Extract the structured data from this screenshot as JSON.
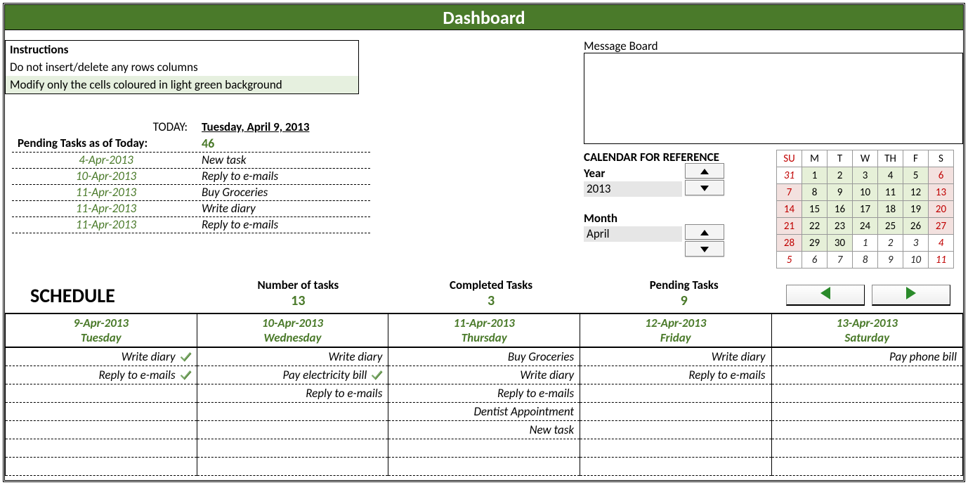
{
  "title": "Dashboard",
  "instructions": {
    "header": "Instructions",
    "line1": "Do not insert/delete any rows columns",
    "line2": "Modify only the cells coloured in light green background"
  },
  "message_board": {
    "label": "Message Board"
  },
  "today": {
    "label": "TODAY:",
    "value": "Tuesday, April 9, 2013"
  },
  "pending_summary": {
    "label": "Pending Tasks as of Today:",
    "count": "46"
  },
  "pending_list": [
    {
      "date": "4-Apr-2013",
      "task": "New task"
    },
    {
      "date": "10-Apr-2013",
      "task": "Reply to e-mails"
    },
    {
      "date": "11-Apr-2013",
      "task": "Buy Groceries"
    },
    {
      "date": "11-Apr-2013",
      "task": "Write diary"
    },
    {
      "date": "11-Apr-2013",
      "task": "Reply to e-mails"
    }
  ],
  "calendar_ref": {
    "header": "CALENDAR FOR REFERENCE",
    "year_label": "Year",
    "year_value": "2013",
    "month_label": "Month",
    "month_value": "April"
  },
  "mini_calendar": {
    "dow": [
      "SU",
      "M",
      "T",
      "W",
      "TH",
      "F",
      "S"
    ],
    "rows": [
      [
        {
          "n": "31",
          "out": true,
          "sun": true
        },
        {
          "n": "1"
        },
        {
          "n": "2"
        },
        {
          "n": "3"
        },
        {
          "n": "4"
        },
        {
          "n": "5"
        },
        {
          "n": "6",
          "sat": true
        }
      ],
      [
        {
          "n": "7",
          "sun": true
        },
        {
          "n": "8"
        },
        {
          "n": "9"
        },
        {
          "n": "10"
        },
        {
          "n": "11"
        },
        {
          "n": "12"
        },
        {
          "n": "13",
          "sat": true
        }
      ],
      [
        {
          "n": "14",
          "sun": true
        },
        {
          "n": "15"
        },
        {
          "n": "16"
        },
        {
          "n": "17"
        },
        {
          "n": "18"
        },
        {
          "n": "19"
        },
        {
          "n": "20",
          "sat": true
        }
      ],
      [
        {
          "n": "21",
          "sun": true
        },
        {
          "n": "22"
        },
        {
          "n": "23"
        },
        {
          "n": "24"
        },
        {
          "n": "25"
        },
        {
          "n": "26"
        },
        {
          "n": "27",
          "sat": true
        }
      ],
      [
        {
          "n": "28",
          "sun": true
        },
        {
          "n": "29"
        },
        {
          "n": "30"
        },
        {
          "n": "1",
          "out": true
        },
        {
          "n": "2",
          "out": true
        },
        {
          "n": "3",
          "out": true
        },
        {
          "n": "4",
          "out": true,
          "sat": true
        }
      ],
      [
        {
          "n": "5",
          "out": true,
          "sun": true
        },
        {
          "n": "6",
          "out": true
        },
        {
          "n": "7",
          "out": true
        },
        {
          "n": "8",
          "out": true
        },
        {
          "n": "9",
          "out": true
        },
        {
          "n": "10",
          "out": true
        },
        {
          "n": "11",
          "out": true,
          "sat": true
        }
      ]
    ]
  },
  "stats": {
    "schedule_label": "SCHEDULE",
    "num_tasks_label": "Number of tasks",
    "num_tasks": "13",
    "completed_label": "Completed Tasks",
    "completed": "3",
    "pending_label": "Pending Tasks",
    "pending": "9"
  },
  "schedule": {
    "days": [
      {
        "date": "9-Apr-2013",
        "name": "Tuesday"
      },
      {
        "date": "10-Apr-2013",
        "name": "Wednesday"
      },
      {
        "date": "11-Apr-2013",
        "name": "Thursday"
      },
      {
        "date": "12-Apr-2013",
        "name": "Friday"
      },
      {
        "date": "13-Apr-2013",
        "name": "Saturday"
      }
    ],
    "grid": [
      [
        {
          "t": "Write diary",
          "done": true
        },
        {
          "t": "Write diary"
        },
        {
          "t": "Buy Groceries"
        },
        {
          "t": "Write diary"
        },
        {
          "t": "Pay phone bill"
        }
      ],
      [
        {
          "t": "Reply to e-mails",
          "done": true
        },
        {
          "t": "Pay electricity bill",
          "done": true
        },
        {
          "t": "Write diary"
        },
        {
          "t": "Reply to e-mails"
        },
        {
          "t": ""
        }
      ],
      [
        {
          "t": ""
        },
        {
          "t": "Reply to e-mails"
        },
        {
          "t": "Reply to e-mails"
        },
        {
          "t": ""
        },
        {
          "t": ""
        }
      ],
      [
        {
          "t": ""
        },
        {
          "t": ""
        },
        {
          "t": "Dentist Appointment"
        },
        {
          "t": ""
        },
        {
          "t": ""
        }
      ],
      [
        {
          "t": ""
        },
        {
          "t": ""
        },
        {
          "t": "New task"
        },
        {
          "t": ""
        },
        {
          "t": ""
        }
      ],
      [
        {
          "t": ""
        },
        {
          "t": ""
        },
        {
          "t": ""
        },
        {
          "t": ""
        },
        {
          "t": ""
        }
      ],
      [
        {
          "t": ""
        },
        {
          "t": ""
        },
        {
          "t": ""
        },
        {
          "t": ""
        },
        {
          "t": ""
        }
      ]
    ]
  }
}
